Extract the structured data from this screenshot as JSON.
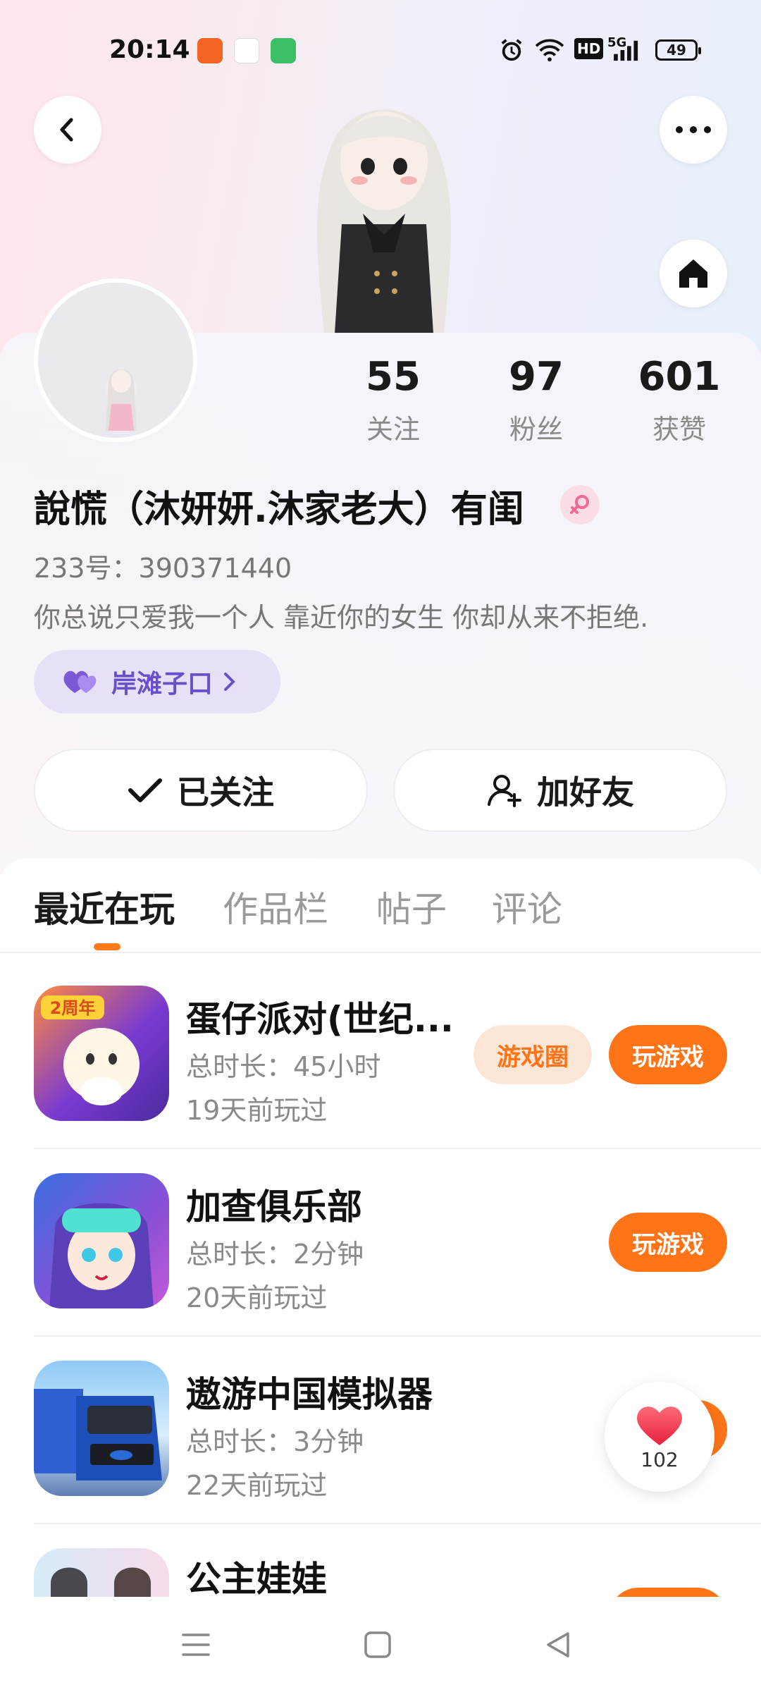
{
  "status_bar": {
    "time": "20:14",
    "battery": "49",
    "network": "5G",
    "hd": "HD"
  },
  "profile": {
    "stats": [
      {
        "value": "55",
        "label": "关注"
      },
      {
        "value": "97",
        "label": "粉丝"
      },
      {
        "value": "601",
        "label": "获赞"
      }
    ],
    "name": "說慌（沐妍妍.沐家老大）有闺",
    "uid": "233号：390371440",
    "bio": "你总说只爱我一个人 靠近你的女生 你却从来不拒绝.",
    "tag_label": "岸滩子口",
    "followed_label": "已关注",
    "add_friend_label": "加好友"
  },
  "tabs": [
    {
      "label": "最近在玩"
    },
    {
      "label": "作品栏"
    },
    {
      "label": "帖子"
    },
    {
      "label": "评论"
    }
  ],
  "games": [
    {
      "title": "蛋仔派对(世纪...",
      "duration": "总时长：45小时",
      "last_played": "19天前玩过",
      "circle_label": "游戏圈",
      "play_label": "玩游戏",
      "icon_badge": "2周年"
    },
    {
      "title": "加查俱乐部",
      "duration": "总时长：2分钟",
      "last_played": "20天前玩过",
      "play_label": "玩游戏"
    },
    {
      "title": "遨游中国模拟器",
      "duration": "总时长：3分钟",
      "last_played": "22天前玩过",
      "play_label": "玩游戏"
    },
    {
      "title": "公主娃娃"
    }
  ],
  "floating_like": {
    "count": "102"
  },
  "colors": {
    "accent": "#ff7417",
    "tag_bg": "#e8e0f7",
    "tag_text": "#6a4fc9"
  }
}
